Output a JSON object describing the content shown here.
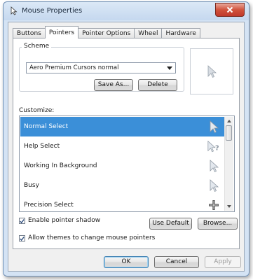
{
  "window": {
    "title": "Mouse Properties",
    "close_icon": "close-icon"
  },
  "tabs": [
    {
      "label": "Buttons"
    },
    {
      "label": "Pointers",
      "active": true
    },
    {
      "label": "Pointer Options"
    },
    {
      "label": "Wheel"
    },
    {
      "label": "Hardware"
    }
  ],
  "scheme": {
    "label": "Scheme",
    "selected": "Aero Premium Cursors normal",
    "save_as_label": "Save As...",
    "delete_label": "Delete"
  },
  "customize": {
    "label": "Customize:",
    "items": [
      {
        "label": "Normal Select",
        "icon": "arrow-cursor-icon",
        "selected": true
      },
      {
        "label": "Help Select",
        "icon": "help-cursor-icon"
      },
      {
        "label": "Working In Background",
        "icon": "arrow-cursor-icon"
      },
      {
        "label": "Busy",
        "icon": "arrow-cursor-icon"
      },
      {
        "label": "Precision Select",
        "icon": "crosshair-cursor-icon"
      }
    ]
  },
  "options": {
    "shadow_label": "Enable pointer shadow",
    "shadow_checked": true,
    "themes_label": "Allow themes to change mouse pointers",
    "themes_checked": true,
    "use_default_label": "Use Default",
    "browse_label": "Browse..."
  },
  "footer": {
    "ok_label": "OK",
    "cancel_label": "Cancel",
    "apply_label": "Apply"
  },
  "colors": {
    "selection": "#3b8fd8",
    "close_button": "#c0392b"
  }
}
